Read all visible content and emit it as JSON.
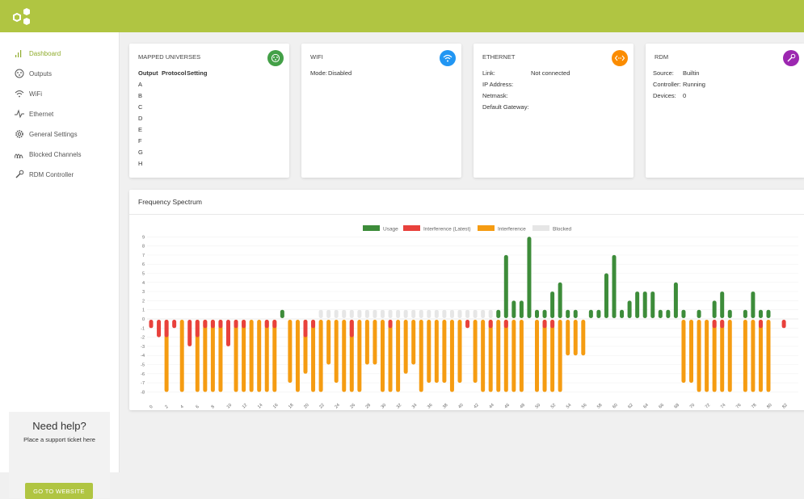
{
  "logo_icon": "hexagon-logo-icon",
  "nav": {
    "items": [
      {
        "label": "Dashboard",
        "icon": "bar-chart-icon",
        "active": true
      },
      {
        "label": "Outputs",
        "icon": "dmx-connector-icon"
      },
      {
        "label": "WiFi",
        "icon": "wifi-icon"
      },
      {
        "label": "Ethernet",
        "icon": "pulse-icon"
      },
      {
        "label": "General Settings",
        "icon": "gear-icon"
      },
      {
        "label": "Blocked Channels",
        "icon": "signal-waves-icon"
      },
      {
        "label": "RDM Controller",
        "icon": "wrench-icon"
      }
    ]
  },
  "help": {
    "title": "Need help?",
    "subtitle": "Place a support ticket here",
    "button": "GO TO WEBSITE"
  },
  "colors": {
    "accent": "#b0c542",
    "usage": "#3d8c3a",
    "interference_latest": "#e8413c",
    "interference": "#f59c12",
    "blocked": "#e6e6e6",
    "mapped_icon": "#43a047",
    "wifi_icon": "#2196f3",
    "ethernet_icon": "#fb8c00",
    "rdm_icon": "#9c27b0"
  },
  "mapped": {
    "title": "MAPPED UNIVERSES",
    "icon": "dmx-connector-icon",
    "headers": [
      "Output",
      "Protocol",
      "Setting"
    ],
    "rows": [
      "A",
      "B",
      "C",
      "D",
      "E",
      "F",
      "G",
      "H"
    ]
  },
  "wifi": {
    "title": "WIFI",
    "icon": "wifi-icon",
    "mode_label": "Mode:",
    "mode_value": "Disabled"
  },
  "ethernet": {
    "title": "ETHERNET",
    "icon": "ethernet-arrows-icon",
    "link_label": "Link:",
    "link_value": "Not connected",
    "ip_label": "IP Address:",
    "netmask_label": "Netmask:",
    "gateway_label": "Default Gateway:"
  },
  "rdm": {
    "title": "RDM",
    "icon": "wrench-icon",
    "source_label": "Source:",
    "source_value": "Builtin",
    "controller_label": "Controller:",
    "controller_value": "Running",
    "devices_label": "Devices:",
    "devices_value": "0"
  },
  "spectrum": {
    "title": "Frequency Spectrum"
  },
  "chart_data": {
    "type": "bar",
    "legend": [
      "Usage",
      "Interference (Latest)",
      "Interference",
      "Blocked"
    ],
    "legend_position": "top",
    "ylim": [
      -8,
      9
    ],
    "y_ticks": [
      9,
      8,
      7,
      6,
      5,
      4,
      3,
      2,
      1,
      0,
      -1,
      -2,
      -3,
      -4,
      -5,
      -6,
      -7,
      -8
    ],
    "x_ticks": [
      0,
      2,
      4,
      6,
      8,
      10,
      12,
      14,
      16,
      18,
      20,
      22,
      24,
      26,
      28,
      30,
      32,
      34,
      36,
      38,
      40,
      42,
      44,
      46,
      48,
      50,
      52,
      54,
      56,
      58,
      60,
      62,
      64,
      66,
      68,
      70,
      72,
      74,
      76,
      78,
      80,
      82
    ],
    "channels": [
      0,
      1,
      2,
      3,
      4,
      5,
      6,
      7,
      8,
      9,
      10,
      11,
      12,
      13,
      14,
      15,
      16,
      17,
      18,
      19,
      20,
      21,
      22,
      23,
      24,
      25,
      26,
      27,
      28,
      29,
      30,
      31,
      32,
      33,
      34,
      35,
      36,
      37,
      38,
      39,
      40,
      41,
      42,
      43,
      44,
      45,
      46,
      47,
      48,
      49,
      50,
      51,
      52,
      53,
      54,
      55,
      56,
      57,
      58,
      59,
      60,
      61,
      62,
      63,
      64,
      65,
      66,
      67,
      68,
      69,
      70,
      71,
      72,
      73,
      74,
      75,
      76,
      77,
      78,
      79,
      80,
      81,
      82,
      83
    ],
    "series": [
      {
        "name": "Usage",
        "values": [
          0,
          0,
          0,
          0,
          0,
          0,
          0,
          0,
          0,
          0,
          0,
          0,
          0,
          0,
          0,
          0,
          0,
          1,
          0,
          0,
          0,
          0,
          0,
          0,
          0,
          0,
          0,
          0,
          0,
          0,
          0,
          0,
          0,
          0,
          0,
          0,
          0,
          0,
          0,
          0,
          0,
          0,
          0,
          0,
          0,
          1,
          7,
          2,
          2,
          9,
          1,
          1,
          3,
          4,
          1,
          1,
          0,
          1,
          1,
          5,
          7,
          1,
          2,
          3,
          3,
          3,
          1,
          1,
          4,
          1,
          0,
          1,
          0,
          2,
          3,
          1,
          0,
          1,
          3,
          1,
          1,
          0,
          0,
          0
        ]
      },
      {
        "name": "Interference (Latest)",
        "values": [
          -1,
          -2,
          -2,
          -1,
          0,
          -3,
          -2,
          -1,
          -1,
          -1,
          -3,
          -1,
          -1,
          0,
          0,
          -1,
          -1,
          0,
          0,
          0,
          -2,
          -1,
          0,
          0,
          0,
          0,
          -2,
          0,
          0,
          0,
          0,
          -1,
          0,
          0,
          0,
          0,
          0,
          0,
          0,
          0,
          0,
          -1,
          0,
          0,
          -1,
          0,
          -1,
          0,
          0,
          0,
          0,
          -1,
          -1,
          0,
          0,
          0,
          0,
          0,
          0,
          0,
          0,
          0,
          0,
          0,
          0,
          0,
          0,
          0,
          0,
          0,
          0,
          0,
          0,
          -1,
          -1,
          0,
          0,
          0,
          0,
          -1,
          0,
          0,
          -1,
          0
        ]
      },
      {
        "name": "Interference",
        "values": [
          0,
          0,
          -8,
          0,
          -8,
          0,
          -8,
          -8,
          -8,
          -8,
          0,
          -8,
          -8,
          -8,
          -8,
          -8,
          -8,
          0,
          -7,
          -8,
          -6,
          -8,
          -8,
          -5,
          -7,
          -8,
          -8,
          -8,
          -5,
          -5,
          -8,
          -8,
          -8,
          -6,
          -5,
          -8,
          -7,
          -7,
          -7,
          -8,
          -7,
          0,
          -7,
          -8,
          -8,
          -8,
          -8,
          -8,
          -8,
          0,
          -8,
          -8,
          -8,
          -8,
          -4,
          -4,
          -4,
          0,
          0,
          0,
          0,
          0,
          0,
          0,
          0,
          0,
          0,
          0,
          0,
          -7,
          -7,
          -8,
          -8,
          -8,
          -8,
          -8,
          0,
          -8,
          -8,
          -8,
          -8,
          0,
          0,
          0
        ]
      },
      {
        "name": "Blocked",
        "values": [
          0,
          0,
          0,
          0,
          0,
          0,
          0,
          0,
          0,
          0,
          0,
          0,
          0,
          0,
          0,
          0,
          0,
          0,
          0,
          0,
          0,
          0,
          1,
          1,
          1,
          1,
          1,
          1,
          1,
          1,
          1,
          1,
          1,
          1,
          1,
          1,
          1,
          1,
          1,
          1,
          1,
          1,
          1,
          1,
          1,
          0,
          0,
          0,
          0,
          0,
          0,
          0,
          0,
          0,
          0,
          0,
          0,
          0,
          0,
          0,
          0,
          0,
          0,
          0,
          0,
          0,
          0,
          0,
          0,
          0,
          0,
          0,
          0,
          0,
          0,
          0,
          0,
          0,
          0,
          0,
          0,
          0,
          0,
          0
        ]
      }
    ]
  }
}
